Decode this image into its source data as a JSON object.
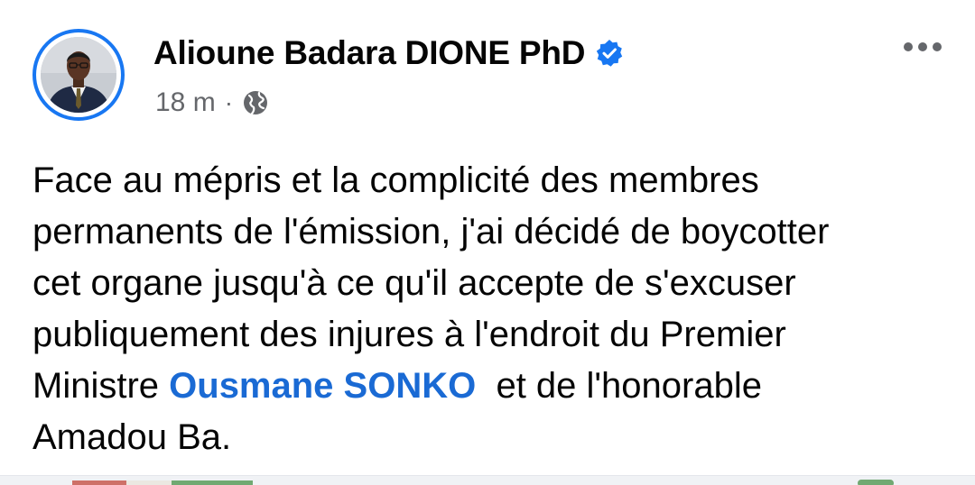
{
  "author": {
    "name": "Alioune Badara DIONE PhD",
    "verified": true,
    "avatar_icon": "profile-photo"
  },
  "meta": {
    "time": "18 m",
    "separator": "·",
    "audience_icon": "globe-icon"
  },
  "menu": {
    "icon": "more-horizontal-icon"
  },
  "post": {
    "line1": "Face au mépris et la complicité des membres",
    "line2": "permanents de l'émission, j'ai décidé de boycotter",
    "line3": "cet organe jusqu'à ce qu'il accepte de s'excuser",
    "line4": "publiquement des injures à l'endroit du Premier",
    "line5_before": "Ministre ",
    "line5_mention": "Ousmane SONKO",
    "line5_after": "  et de l'honorable",
    "line6": "Amadou Ba."
  },
  "colors": {
    "link": "#1a6ad4",
    "verified_badge": "#1877f2",
    "meta_text": "#65676b",
    "avatar_ring": "#1877f2"
  }
}
